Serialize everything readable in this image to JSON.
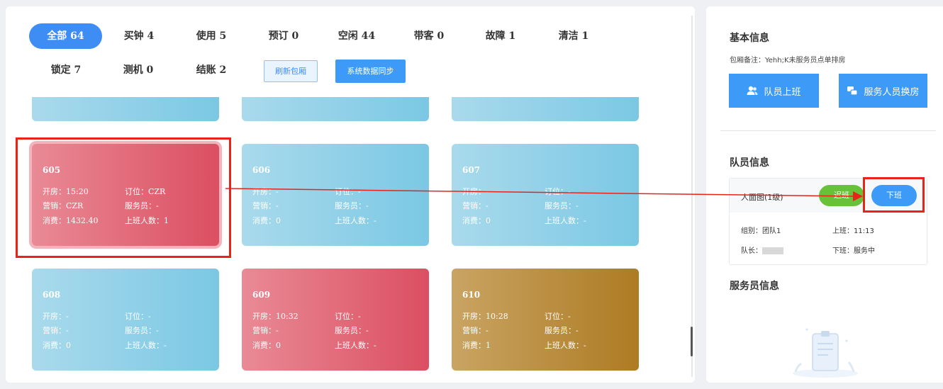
{
  "tabs": [
    {
      "label": "全部 64",
      "active": true
    },
    {
      "label": "买钟 4",
      "active": false
    },
    {
      "label": "使用 5",
      "active": false
    },
    {
      "label": "预订 0",
      "active": false
    },
    {
      "label": "空闲 44",
      "active": false
    },
    {
      "label": "带客 0",
      "active": false
    },
    {
      "label": "故障 1",
      "active": false
    },
    {
      "label": "清洁 1",
      "active": false
    },
    {
      "label": "锁定 7",
      "active": false
    },
    {
      "label": "测机 0",
      "active": false
    },
    {
      "label": "结账 2",
      "active": false
    }
  ],
  "buttons": {
    "refresh": "刷新包厢",
    "sync": "系统数据同步"
  },
  "field_labels": {
    "open": "开房：",
    "order": "订位：",
    "sales": "营销：",
    "waiter": "服务员：",
    "spend": "消费：",
    "staff": "上班人数："
  },
  "rooms": [
    {
      "no": "605",
      "open": "15:20",
      "order": "CZR",
      "sales": "CZR",
      "waiter": "-",
      "spend": "1432.40",
      "staff": "1",
      "color": "#db4f62"
    },
    {
      "no": "606",
      "open": "-",
      "order": "-",
      "sales": "-",
      "waiter": "-",
      "spend": "0",
      "staff": "-",
      "color": "#7bc8e4"
    },
    {
      "no": "607",
      "open": "-",
      "order": "-",
      "sales": "-",
      "waiter": "-",
      "spend": "0",
      "staff": "-",
      "color": "#7bc8e4"
    },
    {
      "no": "608",
      "open": "-",
      "order": "-",
      "sales": "-",
      "waiter": "-",
      "spend": "0",
      "staff": "-",
      "color": "#7bc8e4"
    },
    {
      "no": "609",
      "open": "10:32",
      "order": "-",
      "sales": "-",
      "waiter": "-",
      "spend": "0",
      "staff": "-",
      "color": "#db4f62"
    },
    {
      "no": "610",
      "open": "10:28",
      "order": "-",
      "sales": "-",
      "waiter": "-",
      "spend": "1",
      "staff": "-",
      "color": "#ad7b23"
    }
  ],
  "right": {
    "basic_title": "基本信息",
    "note": "包厢备注：Yehh;K未服务员点单排房",
    "btn_on_duty": "队员上班",
    "btn_swap": "服务人员换房",
    "team_title": "队员信息",
    "member": {
      "name": "人面图(1级)",
      "status": "迟班",
      "off_button": "下班",
      "group": "组别：团队1",
      "on_time": "上班：11:13",
      "leader": "队长：",
      "off_time": "下班：服务中"
    },
    "waiter_title": "服务员信息"
  }
}
